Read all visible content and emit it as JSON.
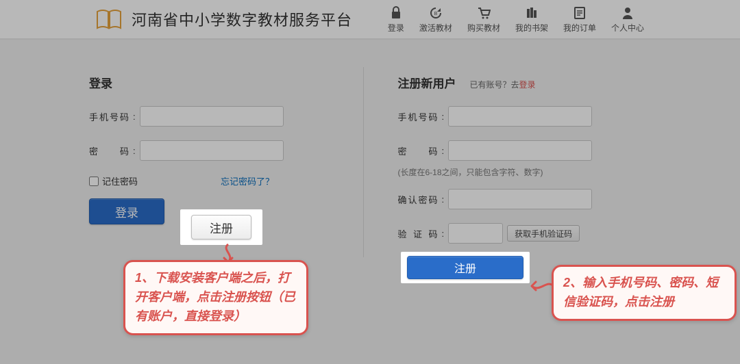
{
  "header": {
    "title": "河南省中小学数字教材服务平台",
    "nav": [
      {
        "label": "登录",
        "icon": "lock-icon"
      },
      {
        "label": "激活教材",
        "icon": "refresh-icon"
      },
      {
        "label": "购买教材",
        "icon": "cart-icon"
      },
      {
        "label": "我的书架",
        "icon": "shelf-icon"
      },
      {
        "label": "我的订单",
        "icon": "order-icon"
      },
      {
        "label": "个人中心",
        "icon": "user-icon"
      }
    ]
  },
  "login": {
    "title": "登录",
    "phone_label": "手机号码",
    "password_label": "密 码",
    "remember_label": "记住密码",
    "forgot_label": "忘记密码了？",
    "login_btn": "登录",
    "register_btn": "注册"
  },
  "register": {
    "title": "注册新用户",
    "have_account_prefix": "已有账号？去",
    "have_account_link": "登录",
    "phone_label": "手机号码",
    "password_label": "密 码",
    "password_hint": "(长度在6-18之间，只能包含字符、数字)",
    "confirm_label": "确认密码",
    "code_label": "验 证 码",
    "get_code_btn": "获取手机验证码",
    "submit_btn": "注册"
  },
  "annotations": {
    "a1": "1、下载安装客户端之后，打开客户端，点击注册按钮（已有账户，直接登录）",
    "a2": "2、输入手机号码、密码、短信验证码，点击注册"
  },
  "colors": {
    "accent": "#2a6dc9",
    "danger": "#d9534f"
  }
}
